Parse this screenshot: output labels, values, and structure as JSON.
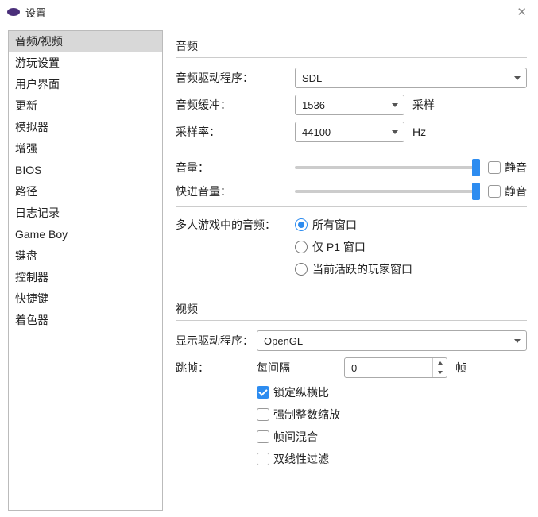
{
  "window": {
    "title": "设置"
  },
  "sidebar": {
    "items": [
      {
        "label": "音频/视频",
        "active": true
      },
      {
        "label": "游玩设置"
      },
      {
        "label": "用户界面"
      },
      {
        "label": "更新"
      },
      {
        "label": "模拟器"
      },
      {
        "label": "增强"
      },
      {
        "label": "BIOS"
      },
      {
        "label": "路径"
      },
      {
        "label": "日志记录"
      },
      {
        "label": "Game Boy"
      },
      {
        "label": "键盘"
      },
      {
        "label": "控制器"
      },
      {
        "label": "快捷键"
      },
      {
        "label": "着色器"
      }
    ]
  },
  "audio": {
    "section_title": "音频",
    "driver_label": "音频驱动程序：",
    "driver_value": "SDL",
    "buffer_label": "音频缓冲：",
    "buffer_value": "1536",
    "buffer_unit": "采样",
    "rate_label": "采样率：",
    "rate_value": "44100",
    "rate_unit": "Hz",
    "volume_label": "音量：",
    "ff_volume_label": "快进音量：",
    "mute_label": "静音",
    "multiplayer_label": "多人游戏中的音频：",
    "radio1": "所有窗口",
    "radio2": "仅 P1 窗口",
    "radio3": "当前活跃的玩家窗口"
  },
  "video": {
    "section_title": "视频",
    "driver_label": "显示驱动程序：",
    "driver_value": "OpenGL",
    "skip_label": "跳帧：",
    "interval_label": "每间隔",
    "interval_value": "0",
    "interval_unit": "帧",
    "lock_aspect": "锁定纵横比",
    "force_int": "强制整数缩放",
    "frame_blend": "帧间混合",
    "bilinear": "双线性过滤"
  }
}
